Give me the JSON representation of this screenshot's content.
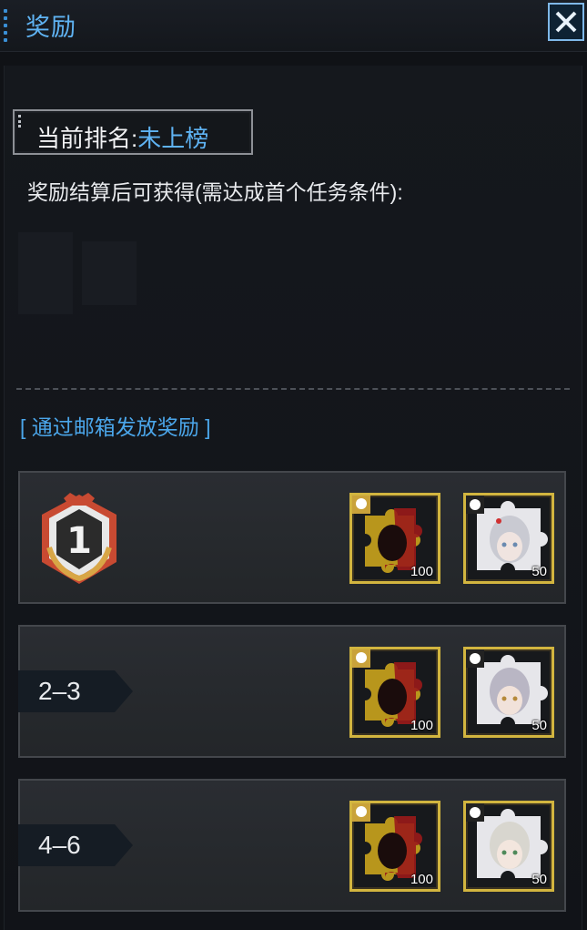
{
  "header": {
    "title": "奖励",
    "close_icon": "close-icon"
  },
  "rank": {
    "label": "当前排名:",
    "value": "未上榜"
  },
  "description": "奖励结算后可获得(需达成首个任务条件):",
  "mail_note": "[ 通过邮箱发放奖励 ]",
  "colors": {
    "accent": "#5fb3f3",
    "gold_frame": "#d2b53f",
    "row_bg": "#2a2d32"
  },
  "rewards": [
    {
      "rank_label": "1",
      "rank_icon": "rank-1-medal-icon",
      "items": [
        {
          "icon": "fragment-puzzle-icon",
          "qty": "100"
        },
        {
          "icon": "character-portrait-fragment-icon",
          "qty": "50"
        }
      ]
    },
    {
      "rank_label": "2–3",
      "items": [
        {
          "icon": "fragment-puzzle-icon",
          "qty": "100"
        },
        {
          "icon": "character-portrait-fragment-icon",
          "qty": "50"
        }
      ]
    },
    {
      "rank_label": "4–6",
      "items": [
        {
          "icon": "fragment-puzzle-icon",
          "qty": "100"
        },
        {
          "icon": "character-portrait-fragment-icon",
          "qty": "50"
        }
      ]
    }
  ]
}
